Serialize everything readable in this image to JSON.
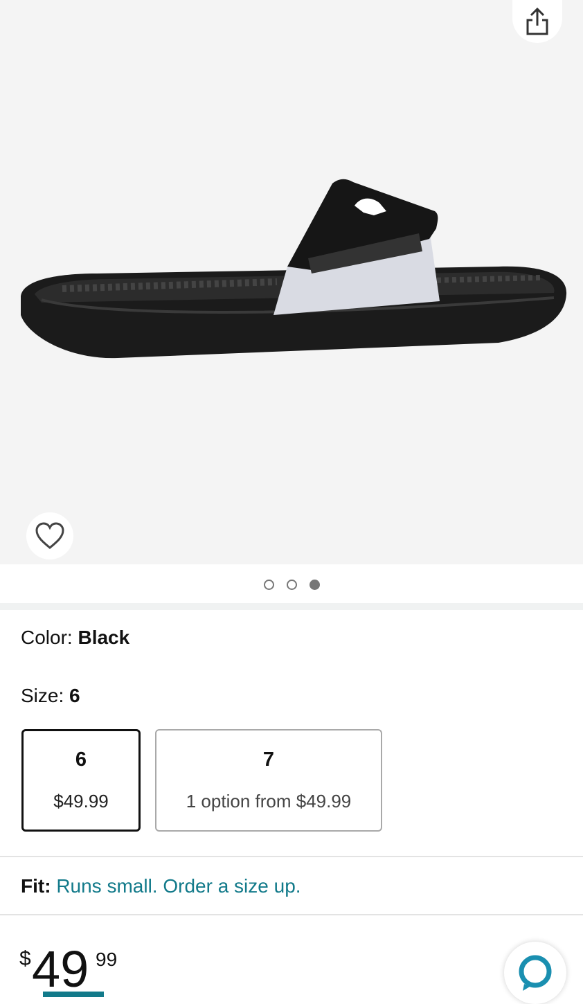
{
  "gallery": {
    "dots": [
      {
        "active": false
      },
      {
        "active": false
      },
      {
        "active": true
      }
    ],
    "image_icon": "sandal-image",
    "share_icon": "share-icon",
    "wishlist_icon": "heart-icon"
  },
  "color": {
    "label": "Color: ",
    "value": "Black"
  },
  "size": {
    "label": "Size: ",
    "value": "6",
    "options": [
      {
        "size": "6",
        "price": "$49.99",
        "selected": true
      },
      {
        "size": "7",
        "price": "1 option from $49.99",
        "selected": false
      }
    ]
  },
  "fit": {
    "label": "Fit:",
    "text": "Runs small. Order a size up."
  },
  "price": {
    "currency": "$",
    "whole": "49",
    "fraction": "99"
  },
  "colors": {
    "accent": "#127a8a",
    "alexa": "#1a8fb0"
  }
}
